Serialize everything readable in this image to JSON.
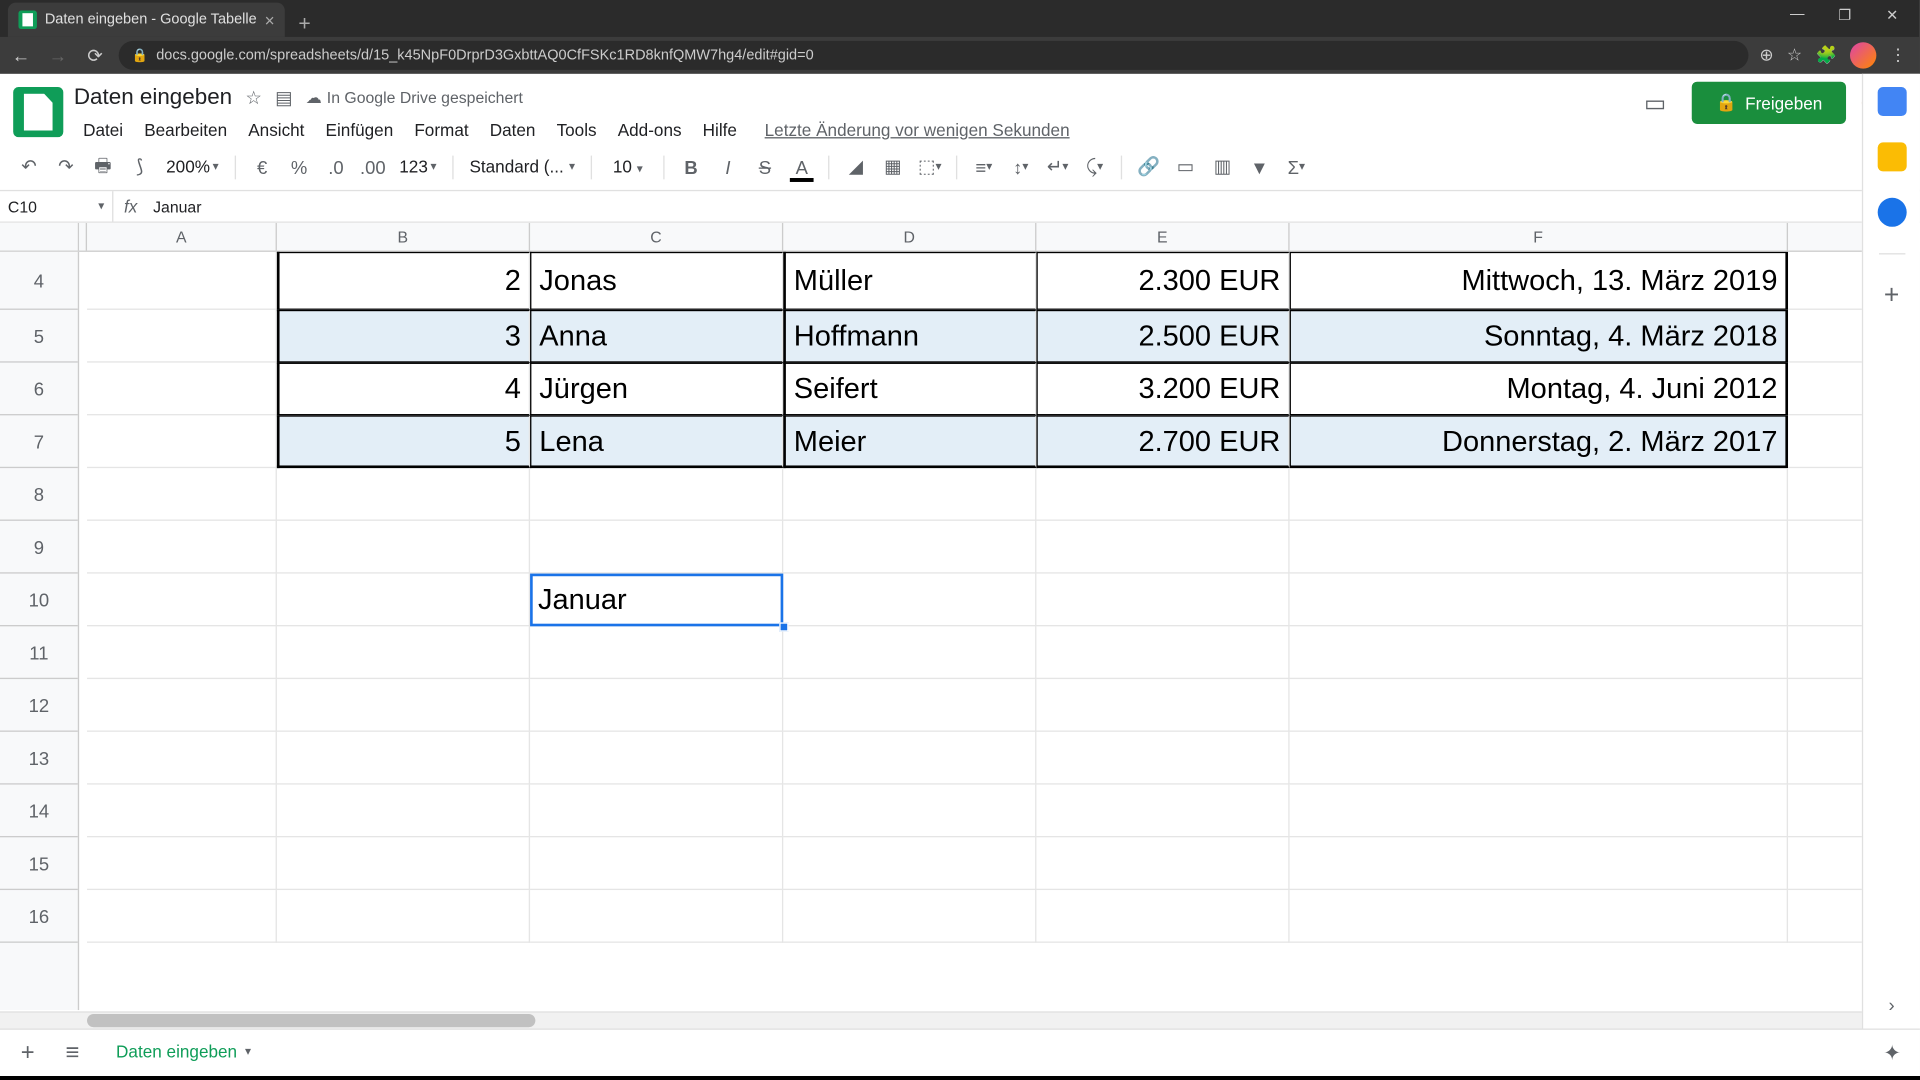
{
  "browser": {
    "tab_title": "Daten eingeben - Google Tabelle",
    "url": "docs.google.com/spreadsheets/d/15_k45NpF0DrprD3GxbttAQ0CfFSKc1RD8knfQMW7hg4/edit#gid=0"
  },
  "doc": {
    "title": "Daten eingeben",
    "save_status": "In Google Drive gespeichert",
    "last_edit": "Letzte Änderung vor wenigen Sekunden"
  },
  "menus": [
    "Datei",
    "Bearbeiten",
    "Ansicht",
    "Einfügen",
    "Format",
    "Daten",
    "Tools",
    "Add-ons",
    "Hilfe"
  ],
  "share_label": "Freigeben",
  "toolbar": {
    "zoom": "200%",
    "format_123": "123",
    "font_style": "Standard (...",
    "font_size": "10"
  },
  "name_box": "C10",
  "formula": "Januar",
  "columns": [
    "A",
    "B",
    "C",
    "D",
    "E",
    "F"
  ],
  "visible_rows": [
    4,
    5,
    6,
    7,
    8,
    9,
    10,
    11,
    12,
    13,
    14,
    15,
    16
  ],
  "data_rows": [
    {
      "row": 4,
      "b": "2",
      "c": "Jonas",
      "d": "Müller",
      "e": "2.300 EUR",
      "f": "Mittwoch, 13. März 2019",
      "alt": false
    },
    {
      "row": 5,
      "b": "3",
      "c": "Anna",
      "d": "Hoffmann",
      "e": "2.500 EUR",
      "f": "Sonntag, 4. März 2018",
      "alt": true
    },
    {
      "row": 6,
      "b": "4",
      "c": "Jürgen",
      "d": "Seifert",
      "e": "3.200 EUR",
      "f": "Montag, 4. Juni 2012",
      "alt": false
    },
    {
      "row": 7,
      "b": "5",
      "c": "Lena",
      "d": "Meier",
      "e": "2.700 EUR",
      "f": "Donnerstag, 2. März 2017",
      "alt": true
    }
  ],
  "selected_cell_value": "Januar",
  "sheet_tab": "Daten eingeben"
}
